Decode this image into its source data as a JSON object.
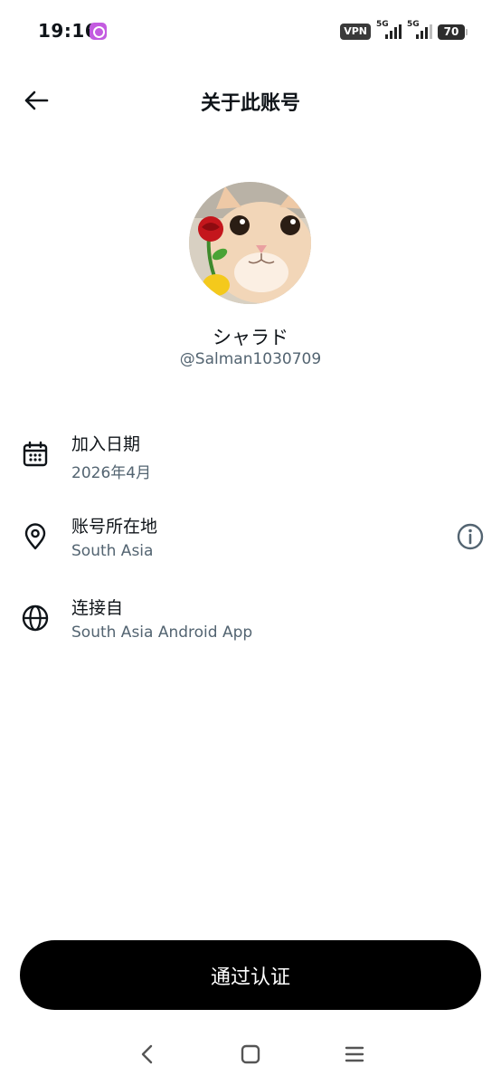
{
  "status_bar": {
    "time": "19:16",
    "vpn": "VPN",
    "network_1": "5G",
    "network_2": "5G",
    "battery": "70"
  },
  "header": {
    "title": "关于此账号",
    "back_icon": "arrow-left-icon"
  },
  "profile": {
    "display_name": "シャラド",
    "handle": "@Salman1030709",
    "avatar": "cat-with-rose-avatar"
  },
  "info": [
    {
      "icon": "calendar-icon",
      "title": "加入日期",
      "value": "2026年4月"
    },
    {
      "icon": "location-pin-icon",
      "title": "账号所在地",
      "value": "South Asia",
      "action_icon": "info-circle-icon"
    },
    {
      "icon": "globe-icon",
      "title": "连接自",
      "value": "South Asia Android App"
    }
  ],
  "verify_button": {
    "label": "通过认证"
  },
  "nav_bar": {
    "back": "chevron-left-icon",
    "home": "square-home-icon",
    "recents": "menu-lines-icon"
  },
  "colors": {
    "text_primary": "#0f1419",
    "text_secondary": "#536471",
    "button_bg": "#000000",
    "button_text": "#ffffff"
  }
}
